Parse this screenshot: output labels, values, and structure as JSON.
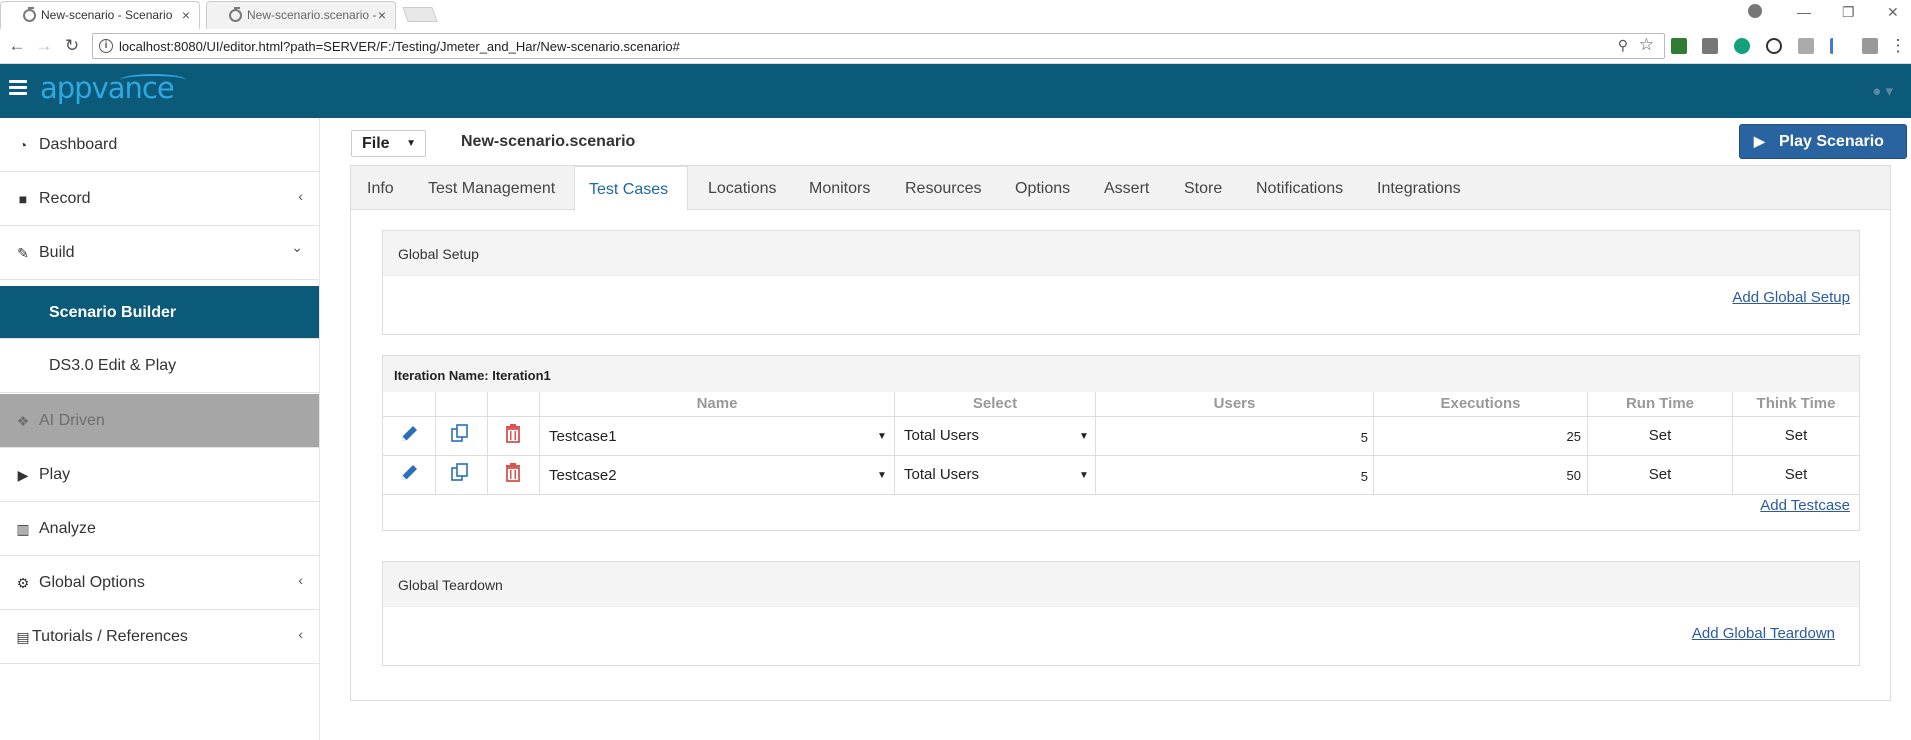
{
  "browser": {
    "tabs": [
      {
        "title": "New-scenario - Scenario"
      },
      {
        "title": "New-scenario.scenario -"
      }
    ],
    "url": "localhost:8080/UI/editor.html?path=SERVER/F:/Testing/Jmeter_and_Har/New-scenario.scenario#",
    "tab_close": "×",
    "nav": {
      "back": "←",
      "forward": "→",
      "reload": "↻"
    },
    "window": {
      "minimize": "—",
      "restore": "❐",
      "close": "✕",
      "menu": "⋮"
    }
  },
  "header": {
    "logo": "appvance",
    "brand_color": "#0b5a7a",
    "logo_color": "#2fa7e0"
  },
  "sidebar": {
    "items": [
      {
        "label": "Dashboard",
        "icon": "dashboard-icon",
        "glyph": "◔",
        "chevron": ""
      },
      {
        "label": "Record",
        "icon": "video-camera-icon",
        "glyph": "■",
        "chevron": "‹"
      },
      {
        "label": "Build",
        "icon": "wrench-icon",
        "glyph": "✎",
        "chevron": "⌄"
      },
      {
        "label": "Scenario Builder",
        "icon": "",
        "glyph": "",
        "chevron": ""
      },
      {
        "label": "DS3.0 Edit & Play",
        "icon": "",
        "glyph": "",
        "chevron": ""
      },
      {
        "label": "AI Driven",
        "icon": "cubes-icon",
        "glyph": "❖",
        "chevron": ""
      },
      {
        "label": "Play",
        "icon": "play-icon",
        "glyph": "▶",
        "chevron": ""
      },
      {
        "label": "Analyze",
        "icon": "bar-chart-icon",
        "glyph": "▥",
        "chevron": ""
      },
      {
        "label": "Global Options",
        "icon": "cogs-icon",
        "glyph": "⚙",
        "chevron": "‹"
      },
      {
        "label": "Tutorials / References",
        "icon": "book-icon",
        "glyph": "▤",
        "chevron": "‹"
      }
    ],
    "active_color": "#0b5a7a"
  },
  "toolbar": {
    "file_label": "File",
    "file_caret": "▼",
    "scenario_name": "New-scenario.scenario",
    "play_label": "Play Scenario",
    "play_glyph": "▶"
  },
  "tabs": [
    {
      "label": "Info"
    },
    {
      "label": "Test Management"
    },
    {
      "label": "Test Cases"
    },
    {
      "label": "Locations"
    },
    {
      "label": "Monitors"
    },
    {
      "label": "Resources"
    },
    {
      "label": "Options"
    },
    {
      "label": "Assert"
    },
    {
      "label": "Store"
    },
    {
      "label": "Notifications"
    },
    {
      "label": "Integrations"
    }
  ],
  "active_tab": "Test Cases",
  "global_setup": {
    "title": "Global Setup",
    "link": "Add Global Setup"
  },
  "iteration": {
    "title": "Iteration Name: Iteration1",
    "columns": [
      "Name",
      "Select",
      "Users",
      "Executions",
      "Run Time",
      "Think Time"
    ],
    "rows": [
      {
        "name": "Testcase1",
        "select": "Total Users",
        "users": "5",
        "executions": "25",
        "run_time": "Set",
        "think_time": "Set"
      },
      {
        "name": "Testcase2",
        "select": "Total Users",
        "users": "5",
        "executions": "50",
        "run_time": "Set",
        "think_time": "Set"
      }
    ],
    "dropdown_glyph": "▼",
    "add_link": "Add Testcase"
  },
  "global_teardown": {
    "title": "Global Teardown",
    "link": "Add Global Teardown"
  },
  "colors": {
    "link": "#2b5a9e",
    "edit_icon": "#2a6fb8",
    "delete_icon": "#d9534f",
    "play_button": "#2a64a0"
  }
}
